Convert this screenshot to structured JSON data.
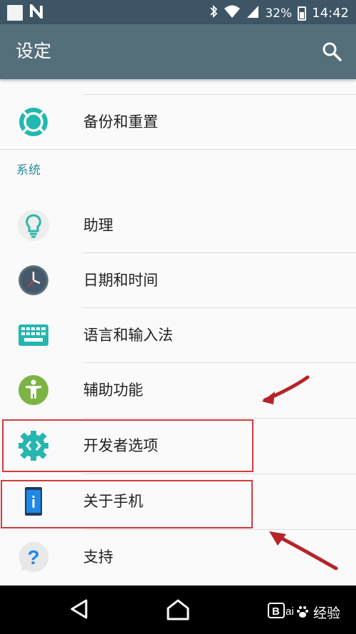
{
  "status_bar": {
    "carrier_icon": "n-icon",
    "battery_percent": "32%",
    "time": "14:42"
  },
  "app_bar": {
    "title": "设定",
    "search_icon": "search-icon"
  },
  "items_top": [
    {
      "label": "备份和重置",
      "icon": "backup-reset-icon"
    }
  ],
  "section": {
    "header": "系统"
  },
  "items_system": [
    {
      "label": "助理",
      "icon": "lightbulb-icon"
    },
    {
      "label": "日期和时间",
      "icon": "clock-icon"
    },
    {
      "label": "语言和输入法",
      "icon": "keyboard-icon"
    },
    {
      "label": "辅助功能",
      "icon": "accessibility-icon"
    },
    {
      "label": "开发者选项",
      "icon": "developer-gear-icon"
    },
    {
      "label": "关于手机",
      "icon": "phone-info-icon"
    },
    {
      "label": "支持",
      "icon": "question-bubble-icon"
    }
  ],
  "watermark": {
    "text": "经验",
    "site": "jingyan.baidu.com"
  },
  "colors": {
    "status_bar": "#3d5565",
    "app_bar": "#546e7a",
    "accent": "#2d8a9b",
    "highlight": "#d43a3e",
    "arrow": "#b5242a"
  }
}
